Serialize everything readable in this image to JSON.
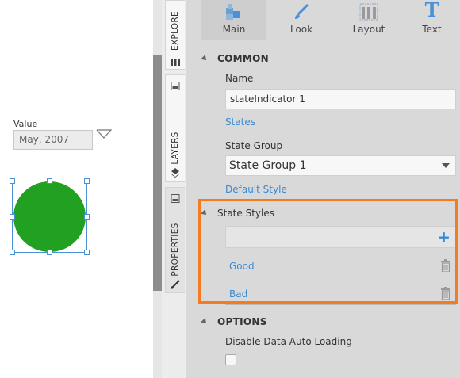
{
  "canvas": {
    "value_label": "Value",
    "value_field": "May, 2007",
    "indicator_color": "#21a021"
  },
  "side_tabs": {
    "explore": "EXPLORE",
    "layers": "LAYERS",
    "properties": "PROPERTIES"
  },
  "toolbar": {
    "main": "Main",
    "look": "Look",
    "layout": "Layout",
    "text": "Text",
    "text_icon": "T"
  },
  "common": {
    "title": "COMMON",
    "name_label": "Name",
    "name_value": "stateIndicator 1",
    "states_link": "States",
    "state_group_label": "State Group",
    "state_group_value": "State Group 1",
    "default_style_link": "Default Style",
    "state_styles_label": "State Styles",
    "state_styles": [
      "Good",
      "Bad"
    ]
  },
  "options": {
    "title": "OPTIONS",
    "disable_auto_loading_label": "Disable Data Auto Loading"
  },
  "colors": {
    "highlight": "#f47b20",
    "link": "#3a8ad0",
    "accent": "#4a90d9"
  }
}
